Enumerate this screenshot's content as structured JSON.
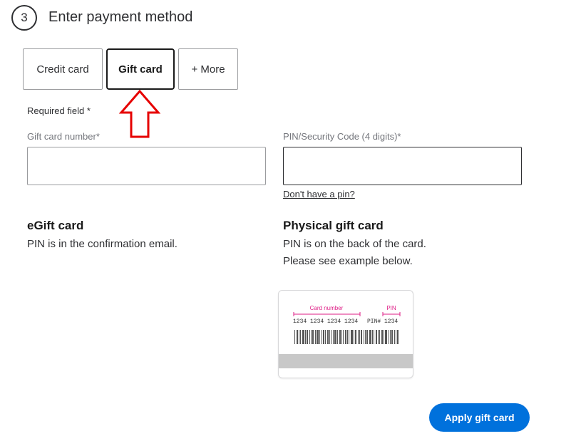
{
  "step": {
    "number": "3",
    "title": "Enter payment method"
  },
  "tabs": [
    {
      "label": "Credit card",
      "active": false
    },
    {
      "label": "Gift card",
      "active": true
    },
    {
      "label": "+ More",
      "active": false
    }
  ],
  "form": {
    "required_note": "Required field *",
    "card_number_label": "Gift card number*",
    "card_number_value": "",
    "pin_label": "PIN/Security Code (4 digits)*",
    "pin_value": "",
    "no_pin_link": "Don't have a pin?"
  },
  "egift": {
    "heading": "eGift card",
    "text": "PIN is in the confirmation email."
  },
  "physical": {
    "heading": "Physical gift card",
    "text1": "PIN is on the back of the card.",
    "text2": "Please see example below."
  },
  "card_example": {
    "card_number_label": "Card number",
    "pin_label": "PIN",
    "card_number_digits": "1234 1234 1234 1234",
    "pin_digits": "PIN# 1234"
  },
  "actions": {
    "apply_label": "Apply gift card"
  },
  "colors": {
    "accent": "#0071dc",
    "highlight_pink": "#de1c85",
    "annotation_red": "#e60000"
  },
  "annotation": {
    "icon": "up-arrow-icon"
  }
}
